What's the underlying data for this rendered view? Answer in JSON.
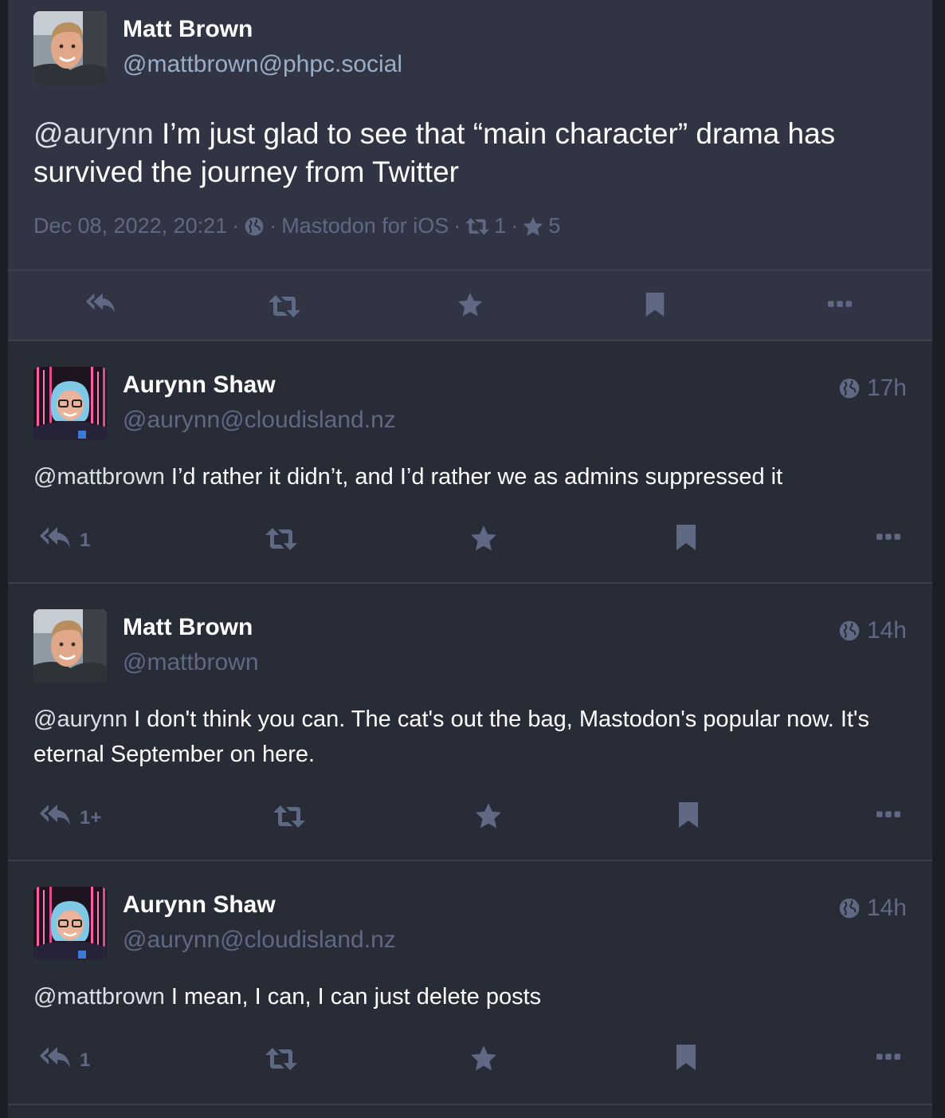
{
  "colors": {
    "background": "#282c37",
    "focal_background": "#313543",
    "muted": "#606984",
    "handle_light": "#9baec8",
    "icon": "#606984"
  },
  "focal": {
    "author_name": "Matt Brown",
    "author_handle": "@mattbrown@phpc.social",
    "mention": "@aurynn",
    "text": " I’m just glad to see that  “main character” drama has survived the journey from Twitter",
    "date": "Dec 08, 2022, 20:21",
    "sep1": "·",
    "sep2": "·",
    "application": "Mastodon for iOS",
    "sep3": "·",
    "boost_count": "1",
    "sep4": "·",
    "favourite_count": "5",
    "visibility_icon": "globe-icon",
    "actions": [
      "reply-all-icon",
      "boost-icon",
      "star-icon",
      "bookmark-icon",
      "more-icon"
    ]
  },
  "replies": [
    {
      "author_name": "Aurynn Shaw",
      "author_handle": "@aurynn@cloudisland.nz",
      "time": "17h",
      "mention": "@mattbrown",
      "text": " I’d rather it didn’t, and I’d rather we as admins suppressed it",
      "reply_count": "1"
    },
    {
      "author_name": "Matt Brown",
      "author_handle": "@mattbrown",
      "time": "14h",
      "mention": "@aurynn",
      "text": " I don't think you can. The cat's out the bag, Mastodon's popular now. It's eternal September on here.",
      "reply_count": "1+"
    },
    {
      "author_name": "Aurynn Shaw",
      "author_handle": "@aurynn@cloudisland.nz",
      "time": "14h",
      "mention": "@mattbrown",
      "text": " I mean, I can, I can just delete posts",
      "reply_count": "1"
    }
  ]
}
